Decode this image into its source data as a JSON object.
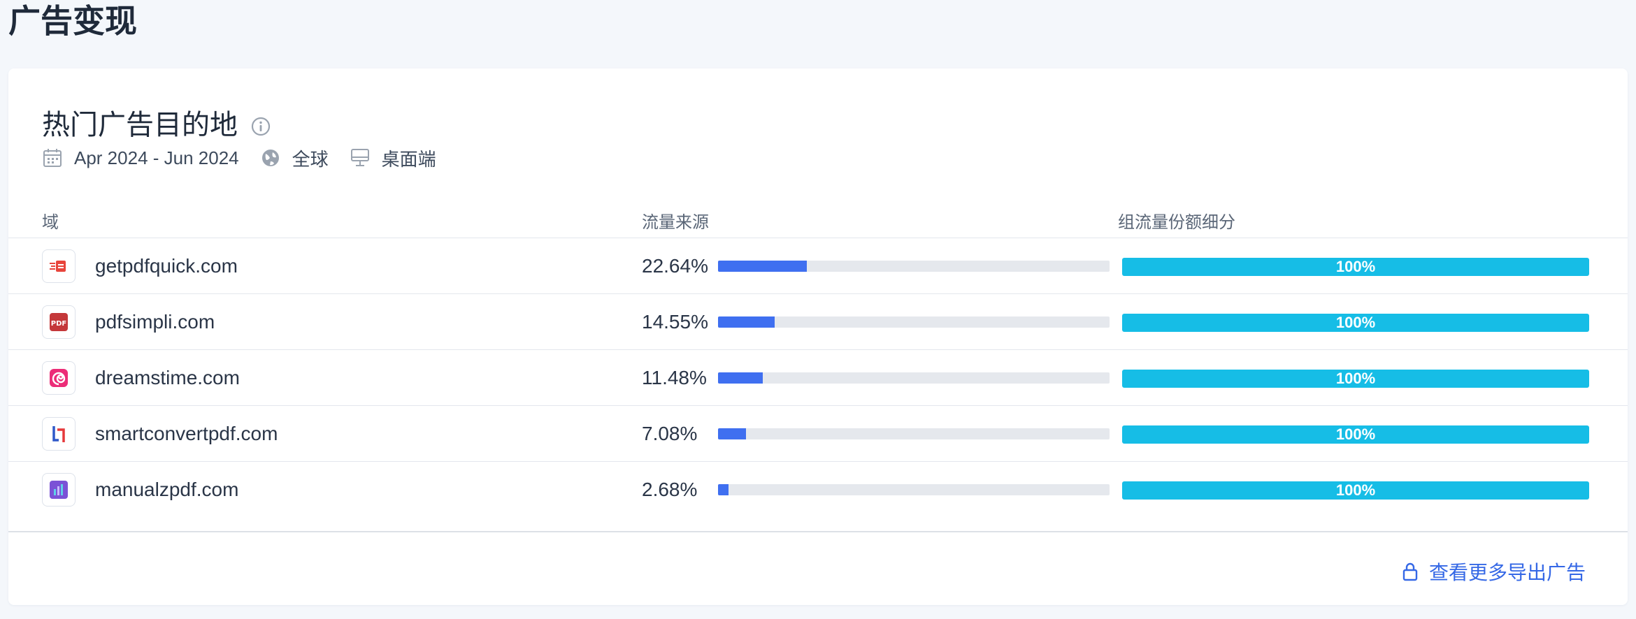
{
  "page": {
    "title": "广告变现"
  },
  "card": {
    "title": "热门广告目的地",
    "date_range": "Apr 2024 - Jun 2024",
    "region": "全球",
    "device": "桌面端"
  },
  "table": {
    "headers": {
      "domain": "域",
      "traffic": "流量来源",
      "share": "组流量份额细分"
    },
    "rows": [
      {
        "domain": "getpdfquick.com",
        "traffic_pct": "22.64%",
        "traffic_value": 22.64,
        "share": "100%",
        "icon": "getpdfquick-favicon"
      },
      {
        "domain": "pdfsimpli.com",
        "traffic_pct": "14.55%",
        "traffic_value": 14.55,
        "share": "100%",
        "icon": "pdfsimpli-favicon"
      },
      {
        "domain": "dreamstime.com",
        "traffic_pct": "11.48%",
        "traffic_value": 11.48,
        "share": "100%",
        "icon": "dreamstime-favicon"
      },
      {
        "domain": "smartconvertpdf.com",
        "traffic_pct": "7.08%",
        "traffic_value": 7.08,
        "share": "100%",
        "icon": "smartconvertpdf-favicon"
      },
      {
        "domain": "manualzpdf.com",
        "traffic_pct": "2.68%",
        "traffic_value": 2.68,
        "share": "100%",
        "icon": "manualzpdf-favicon"
      }
    ]
  },
  "footer": {
    "more_label": "查看更多导出广告"
  },
  "colors": {
    "bar": "#3f6ff0",
    "share": "#16bde6",
    "link": "#3568e6"
  }
}
